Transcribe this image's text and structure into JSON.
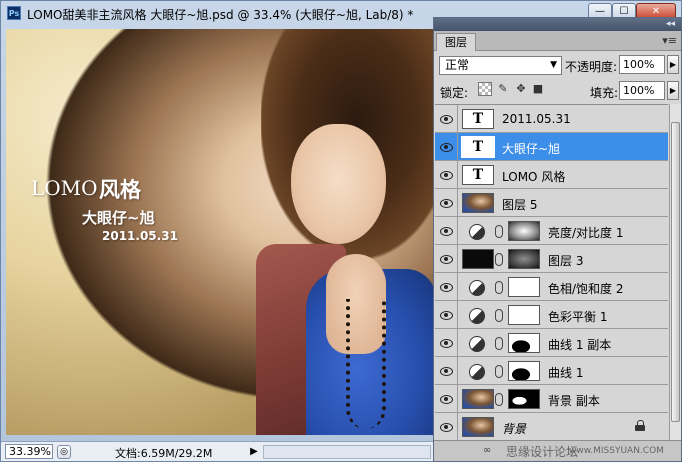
{
  "document": {
    "app_icon": "Ps",
    "title": "LOMO甜美非主流风格  大眼仔~旭.psd @ 33.4% (大眼仔~旭, Lab/8) *",
    "window_controls": {
      "minimize": "—",
      "maximize": "☐",
      "close": "✕"
    },
    "canvas_text": {
      "lomo": "LOMO",
      "fengge": "风格",
      "name": "大眼仔~旭",
      "date": "2011.05.31"
    },
    "status": {
      "zoom": "33.39%",
      "doc_info": "文档:6.59M/29.2M",
      "arrow": "▶"
    }
  },
  "layers_panel": {
    "tab_label": "图层",
    "collapse_glyph": "◂◂",
    "menu_glyph": "▾≡",
    "blend_mode": "正常",
    "opacity_label": "不透明度:",
    "opacity_value": "100%",
    "lock_label": "锁定:",
    "fill_label": "填充:",
    "fill_value": "100%",
    "layers": [
      {
        "name": "2011.05.31",
        "kind": "text",
        "glyph": "T",
        "selected": false
      },
      {
        "name": "大眼仔~旭",
        "kind": "text",
        "glyph": "T",
        "selected": true
      },
      {
        "name": "LOMO 风格",
        "kind": "text",
        "glyph": "T",
        "selected": false
      },
      {
        "name": "图层 5",
        "kind": "pixel",
        "thumb": "photo",
        "selected": false
      },
      {
        "name": "亮度/对比度 1",
        "kind": "adjustment",
        "mask": "grad",
        "selected": false
      },
      {
        "name": "图层 3",
        "kind": "pixel-mask",
        "thumb": "black",
        "mask": "dark-grad",
        "selected": false
      },
      {
        "name": "色相/饱和度 2",
        "kind": "adjustment",
        "mask": "white",
        "selected": false
      },
      {
        "name": "色彩平衡 1",
        "kind": "adjustment",
        "mask": "white",
        "selected": false
      },
      {
        "name": "曲线 1 副本",
        "kind": "adjustment",
        "mask": "curves",
        "selected": false
      },
      {
        "name": "曲线 1",
        "kind": "adjustment",
        "mask": "curves",
        "selected": false
      },
      {
        "name": "背景 副本",
        "kind": "pixel-mask",
        "thumb": "photo",
        "mask": "bgmask",
        "selected": false
      },
      {
        "name": "背景",
        "kind": "background",
        "thumb": "photo",
        "selected": false
      }
    ],
    "watermark": "思缘设计论坛",
    "watermark_url": "www.MISSYUAN.COM"
  }
}
